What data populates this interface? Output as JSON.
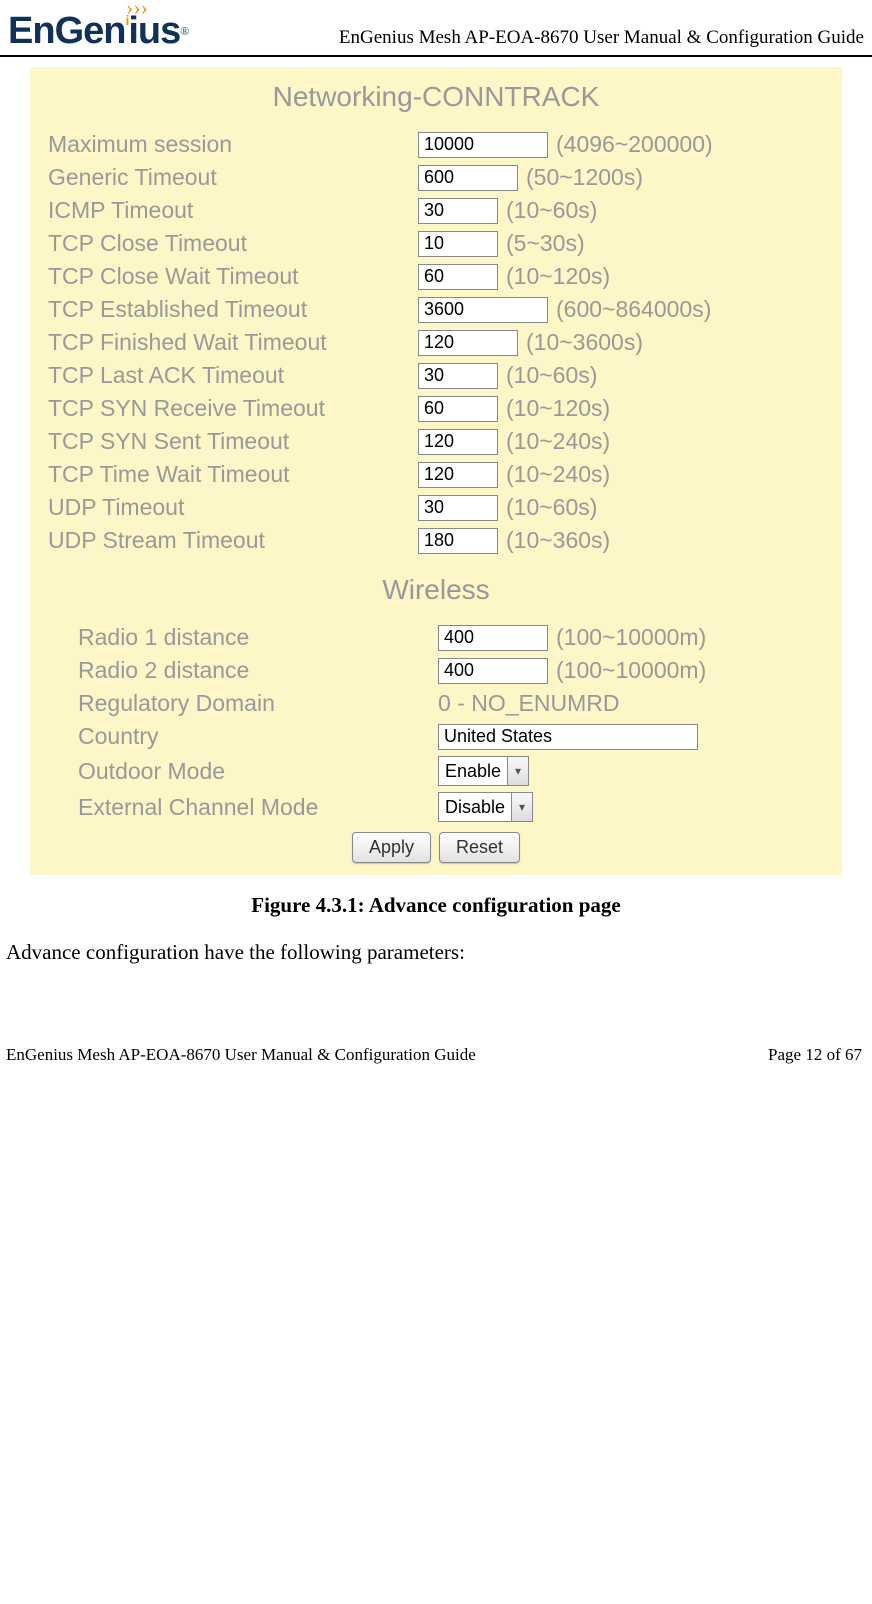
{
  "header": {
    "brand1": "En",
    "brand2": "Gen",
    "brand3": "ius",
    "tm": "®",
    "title": "EnGenius Mesh AP-EOA-8670 User Manual & Configuration Guide"
  },
  "panel": {
    "section1_title": "Networking-CONNTRACK",
    "conntrack": [
      {
        "label": "Maximum session",
        "value": "10000",
        "width": "130",
        "range": "(4096~200000)"
      },
      {
        "label": "Generic Timeout",
        "value": "600",
        "width": "100",
        "range": "(50~1200s)"
      },
      {
        "label": "ICMP Timeout",
        "value": "30",
        "width": "80",
        "range": "(10~60s)"
      },
      {
        "label": "TCP Close Timeout",
        "value": "10",
        "width": "80",
        "range": "(5~30s)"
      },
      {
        "label": "TCP Close Wait Timeout",
        "value": "60",
        "width": "80",
        "range": "(10~120s)"
      },
      {
        "label": "TCP Established Timeout",
        "value": "3600",
        "width": "130",
        "range": "(600~864000s)"
      },
      {
        "label": "TCP Finished Wait Timeout",
        "value": "120",
        "width": "100",
        "range": "(10~3600s)"
      },
      {
        "label": "TCP Last ACK Timeout",
        "value": "30",
        "width": "80",
        "range": "(10~60s)"
      },
      {
        "label": "TCP SYN Receive Timeout",
        "value": "60",
        "width": "80",
        "range": "(10~120s)"
      },
      {
        "label": "TCP SYN Sent Timeout",
        "value": "120",
        "width": "80",
        "range": "(10~240s)"
      },
      {
        "label": "TCP Time Wait Timeout",
        "value": "120",
        "width": "80",
        "range": "(10~240s)"
      },
      {
        "label": "UDP Timeout",
        "value": "30",
        "width": "80",
        "range": "(10~60s)"
      },
      {
        "label": "UDP Stream Timeout",
        "value": "180",
        "width": "80",
        "range": "(10~360s)"
      }
    ],
    "section2_title": "Wireless",
    "wireless": {
      "radio1": {
        "label": "Radio 1 distance",
        "value": "400",
        "width": "110",
        "range": "(100~10000m)"
      },
      "radio2": {
        "label": "Radio 2 distance",
        "value": "400",
        "width": "110",
        "range": "(100~10000m)"
      },
      "regdom": {
        "label": "Regulatory Domain",
        "value": "0 - NO_ENUMRD"
      },
      "country": {
        "label": "Country",
        "value": "United States"
      },
      "outdoor": {
        "label": "Outdoor Mode",
        "value": "Enable"
      },
      "extchan": {
        "label": "External Channel Mode",
        "value": "Disable"
      }
    },
    "buttons": {
      "apply": "Apply",
      "reset": "Reset"
    }
  },
  "caption": "Figure 4.3.1: Advance configuration page",
  "body_text": "Advance configuration have the following parameters:",
  "footer": {
    "left": "EnGenius Mesh AP-EOA-8670 User Manual & Configuration Guide",
    "right": "Page 12 of 67"
  }
}
